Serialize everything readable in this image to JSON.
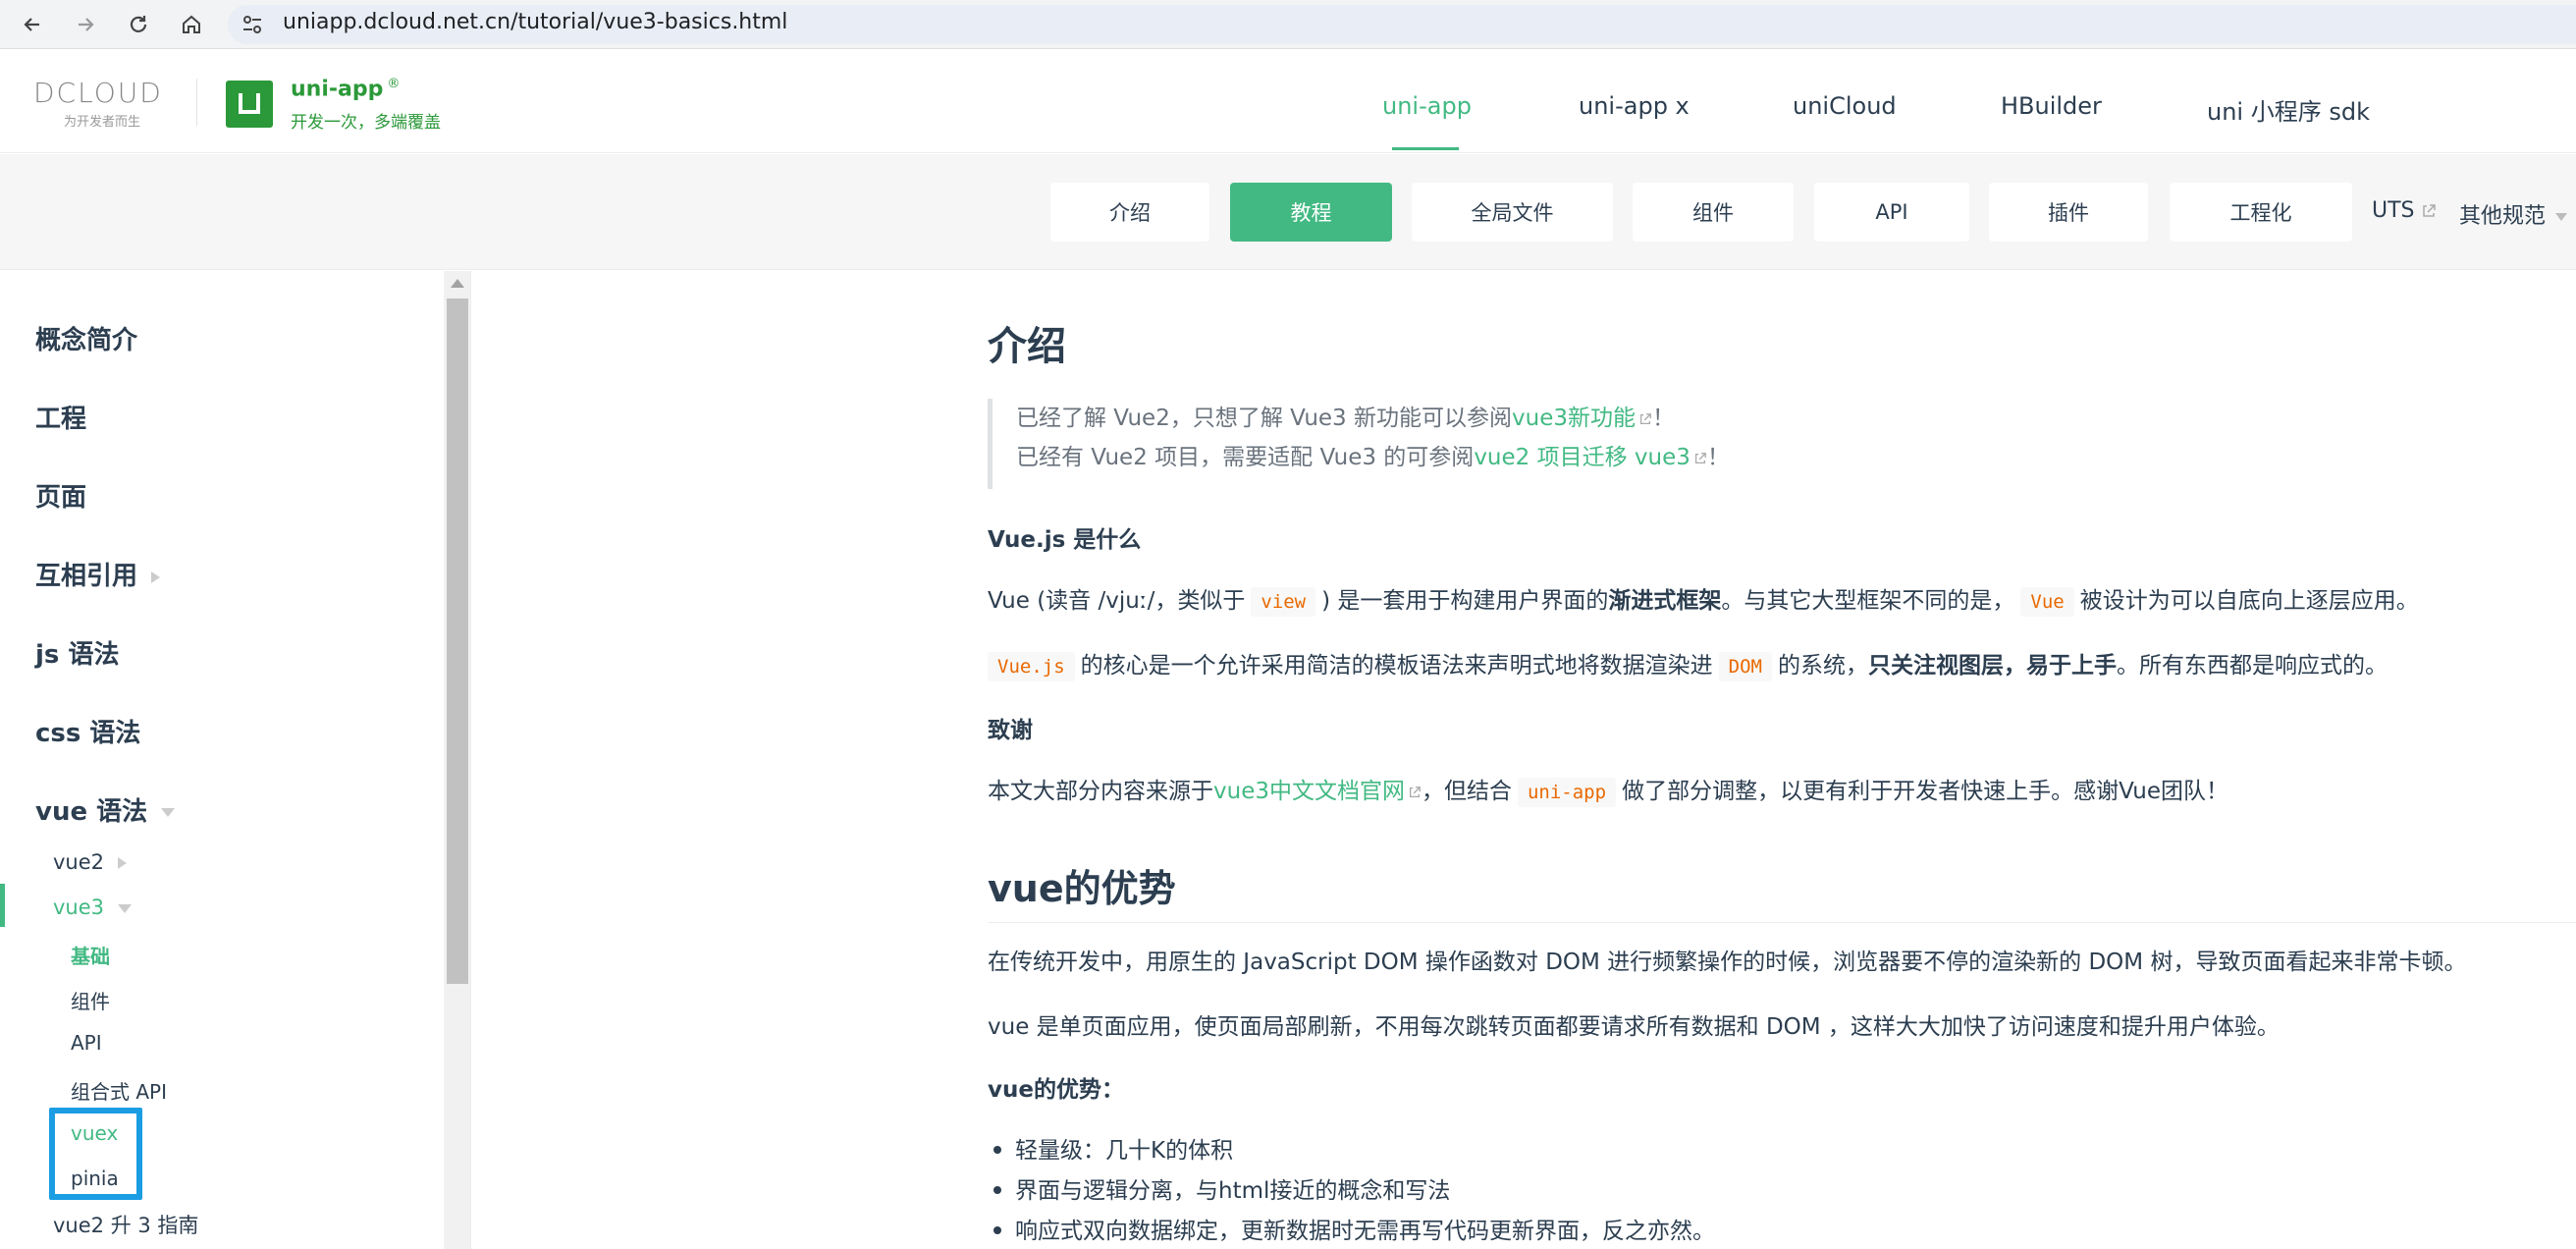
{
  "browser": {
    "url": "uniapp.dcloud.net.cn/tutorial/vue3-basics.html"
  },
  "header": {
    "dcloud_logo": "DCLOUD",
    "dcloud_slogan": "为开发者而生",
    "uni_title": "uni-app",
    "uni_reg": "®",
    "uni_subtitle": "开发一次，多端覆盖",
    "nav": [
      "uni-app",
      "uni-app x",
      "uniCloud",
      "HBuilder",
      "uni 小程序 sdk"
    ]
  },
  "subnav": {
    "buttons": [
      "介绍",
      "教程",
      "全局文件",
      "组件",
      "API",
      "插件",
      "工程化"
    ],
    "uts": "UTS",
    "other": "其他规范"
  },
  "sidebar": {
    "groups": [
      "概念简介",
      "工程",
      "页面",
      "互相引用",
      "js 语法",
      "css 语法",
      "vue 语法"
    ],
    "vue2": "vue2",
    "vue3": "vue3",
    "vue3_children": [
      "基础",
      "组件",
      "API",
      "组合式 API",
      "vuex",
      "pinia"
    ],
    "upgrade_guide": "vue2 升 3 指南"
  },
  "content": {
    "h1": "介绍",
    "quote_line1_pre": "已经了解 Vue2，只想了解 Vue3 新功能可以参阅",
    "quote_line1_link": "vue3新功能",
    "quote_line1_post": "！",
    "quote_line2_pre": "已经有 Vue2 项目，需要适配 Vue3 的可参阅",
    "quote_line2_link": "vue2 项目迁移 vue3",
    "quote_line2_post": "！",
    "h4_what": "Vue.js 是什么",
    "p1_a": "Vue (读音 /vjuː/，类似于",
    "p1_code1": "view",
    "p1_b": ") 是一套用于构建用户界面的",
    "p1_bold": "渐进式框架",
    "p1_c": "。与其它大型框架不同的是，",
    "p1_code2": "Vue",
    "p1_d": "被设计为可以自底向上逐层应用。",
    "p2_code1": "Vue.js",
    "p2_a": "的核心是一个允许采用简洁的模板语法来声明式地将数据渲染进",
    "p2_code2": "DOM",
    "p2_b": "的系统，",
    "p2_bold": "只关注视图层，易于上手",
    "p2_c": "。所有东西都是响应式的。",
    "h4_thanks": "致谢",
    "p3_a": "本文大部分内容来源于",
    "p3_link": "vue3中文文档官网",
    "p3_b": "，但结合",
    "p3_code": "uni-app",
    "p3_c": "做了部分调整，以更有利于开发者快速上手。感谢Vue团队！",
    "h2": "vue的优势",
    "p4": "在传统开发中，用原生的 JavaScript DOM 操作函数对 DOM 进行频繁操作的时候，浏览器要不停的渲染新的 DOM 树，导致页面看起来非常卡顿。",
    "p5": "vue 是单页面应用，使页面局部刷新，不用每次跳转页面都要请求所有数据和 DOM ，这样大大加快了访问速度和提升用户体验。",
    "h4_adv": "vue的优势：",
    "list": [
      "轻量级：几十K的体积",
      "界面与逻辑分离，与html接近的概念和写法",
      "响应式双向数据绑定，更新数据时无需再写代码更新界面，反之亦然。"
    ]
  },
  "colors": {
    "accent": "#42b983",
    "brand_green": "#2b9939",
    "highlight_box": "#1a9de3"
  }
}
